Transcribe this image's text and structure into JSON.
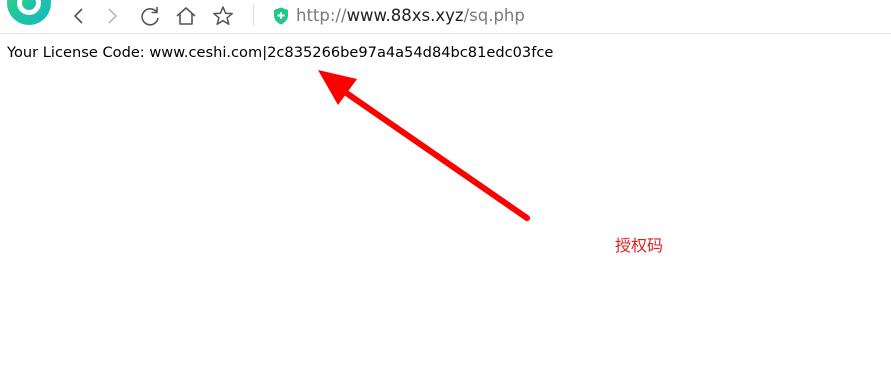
{
  "colors": {
    "accent_green": "#1ec98b",
    "arrow_red": "#ff0000",
    "annotation_red": "#e02020",
    "icon_gray": "#555555"
  },
  "browser": {
    "icons": [
      "browser-logo-icon",
      "back-icon",
      "forward-icon",
      "reload-icon",
      "home-icon",
      "bookmark-star-icon",
      "secure-shield-icon"
    ],
    "address_bar": {
      "protocol": "http://",
      "host": "www.88xs.xyz",
      "path": "/sq.php"
    }
  },
  "page": {
    "license_label": "Your License Code: ",
    "license_value": "www.ceshi.com|2c835266be97a4a54d84bc81edc03fce"
  },
  "annotation": {
    "text": "授权码"
  }
}
